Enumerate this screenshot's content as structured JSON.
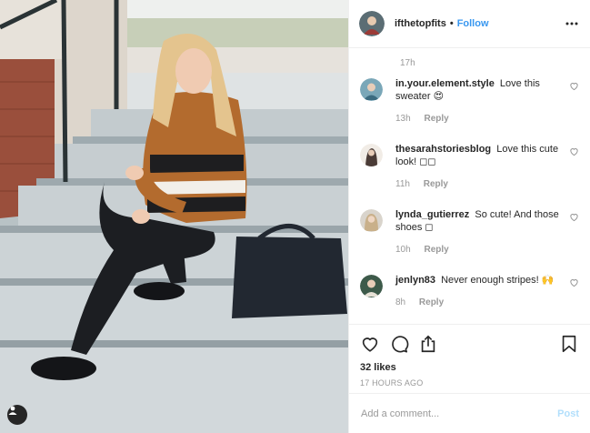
{
  "post": {
    "author": "ifthetopfits",
    "follow_label": "Follow",
    "separator": "•",
    "more_icon": "more-options-icon",
    "caption_time": "17h"
  },
  "comments": [
    {
      "user": "in.your.element.style",
      "text": "Love this sweater 😍",
      "time": "13h",
      "reply": "Reply",
      "avatar_color": "#7aa7b8"
    },
    {
      "user": "thesarahstoriesblog",
      "text": "Love this cute look! ◻◻",
      "time": "11h",
      "reply": "Reply",
      "avatar_color": "#4a3b36"
    },
    {
      "user": "lynda_gutierrez",
      "text": "So cute! And those shoes ◻",
      "time": "10h",
      "reply": "Reply",
      "avatar_color": "#c9b08a"
    },
    {
      "user": "jenlyn83",
      "text": "Never enough stripes! 🙌",
      "time": "8h",
      "reply": "Reply",
      "avatar_color": "#3d5a4a"
    }
  ],
  "actions": {
    "like_icon": "heart-icon",
    "comment_icon": "comment-icon",
    "share_icon": "share-icon",
    "save_icon": "bookmark-icon"
  },
  "likes": "32 likes",
  "posted": "17 HOURS AGO",
  "add_comment": {
    "placeholder": "Add a comment...",
    "post_label": "Post"
  },
  "colors": {
    "link_blue": "#3897f0",
    "post_disabled": "#b2dffc",
    "meta_gray": "#999999",
    "text": "#262626",
    "border": "#efefef"
  }
}
